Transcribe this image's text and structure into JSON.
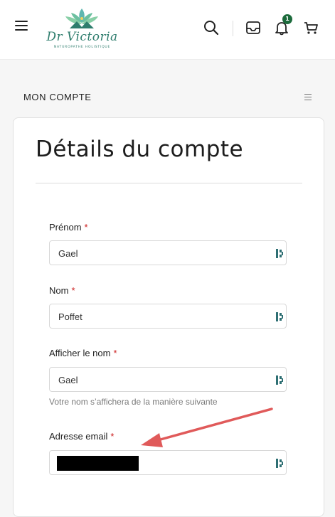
{
  "header": {
    "logo": {
      "name": "Dr Victoria",
      "tagline": "NATUROPATHE HOLISTIQUE"
    },
    "notification_count": "1",
    "accent_color": "#1c6b3c"
  },
  "section": {
    "title": "MON COMPTE"
  },
  "card": {
    "title": "Détails du compte",
    "fields": [
      {
        "label": "Prénom",
        "required": "*",
        "value": "Gael"
      },
      {
        "label": "Nom",
        "required": "*",
        "value": "Poffet"
      },
      {
        "label": "Afficher le nom",
        "required": "*",
        "value": "Gael",
        "hint": "Votre nom s’affichera de la manière suivante"
      },
      {
        "label": "Adresse email",
        "required": "*",
        "value": ""
      }
    ]
  },
  "annotation": {
    "arrow_color": "#e05a5a"
  }
}
